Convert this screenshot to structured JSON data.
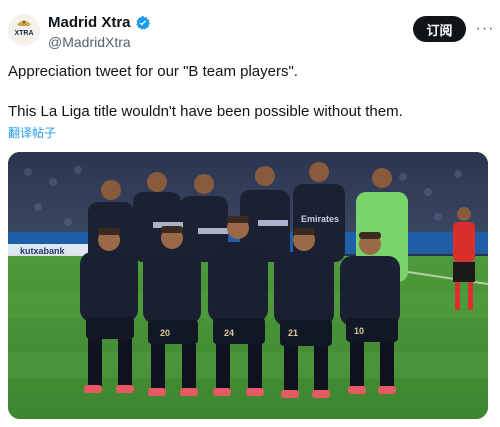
{
  "tweet": {
    "author": {
      "display_name": "Madrid Xtra",
      "handle": "@MadridXtra",
      "avatar_icon": "madrid-xtra-logo-icon",
      "avatar_text": "XTRA",
      "verified": true,
      "verified_icon": "verified-badge-icon"
    },
    "subscribe_label": "订阅",
    "more_icon": "more-options-icon",
    "text_line1": "Appreciation tweet for our \"B team players\".",
    "text_line2": "This La Liga title wouldn't have been possible without them.",
    "translate_label": "翻译帖子",
    "media": {
      "kind": "photo",
      "description_icon": "team-photo-image",
      "sponsor_text": "Emirates",
      "board_text": "kutxabank",
      "shirt_numbers": [
        "20",
        "24",
        "21",
        "10"
      ]
    }
  },
  "colors": {
    "primary_text": "#0f1419",
    "secondary_text": "#536471",
    "accent_blue": "#1d9bf0",
    "button_bg": "#0f1419"
  }
}
